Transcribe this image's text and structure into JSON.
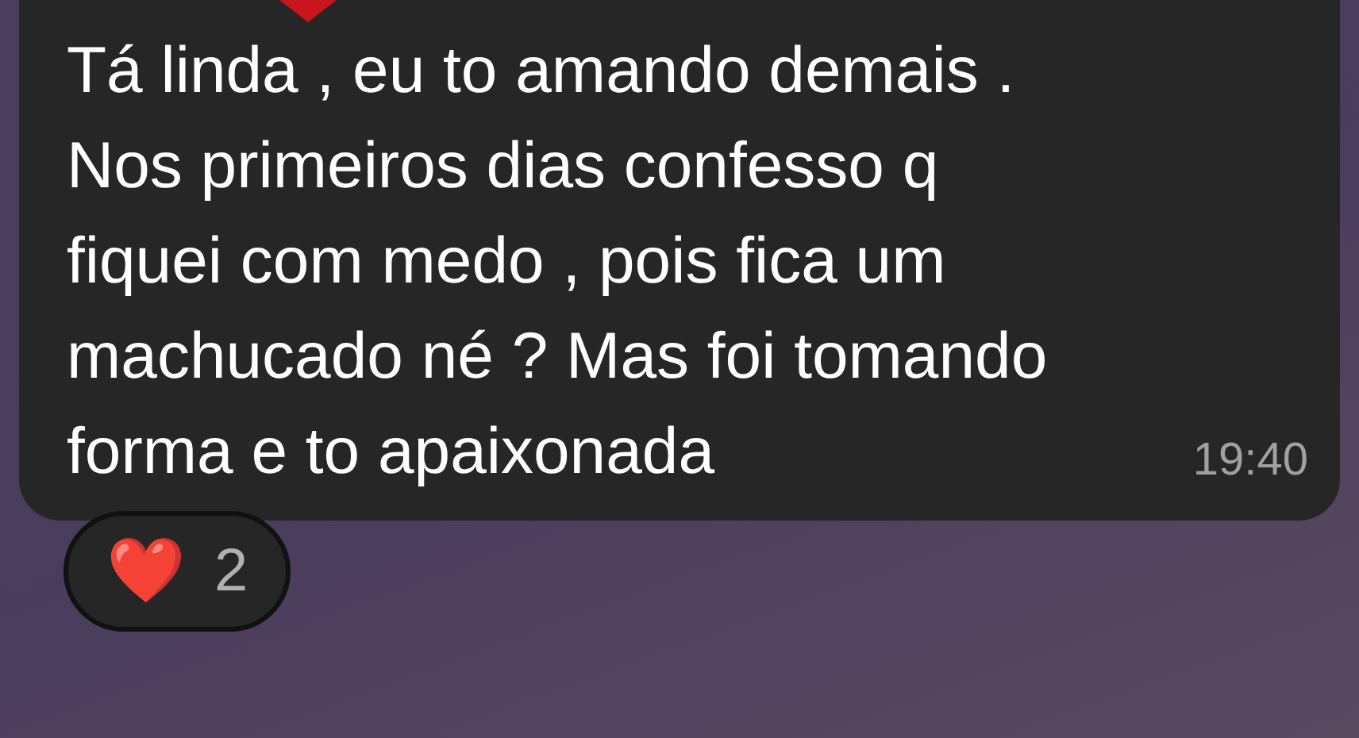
{
  "message": {
    "text": "Tá linda , eu to amando demais .\nNos primeiros dias confesso q\nfiquei com medo , pois fica um\nmachucado né ? Mas foi tomando\nforma e to apaixonada",
    "time": "19:40"
  },
  "reactions": [
    {
      "emoji": "❤️",
      "count": "2"
    }
  ]
}
